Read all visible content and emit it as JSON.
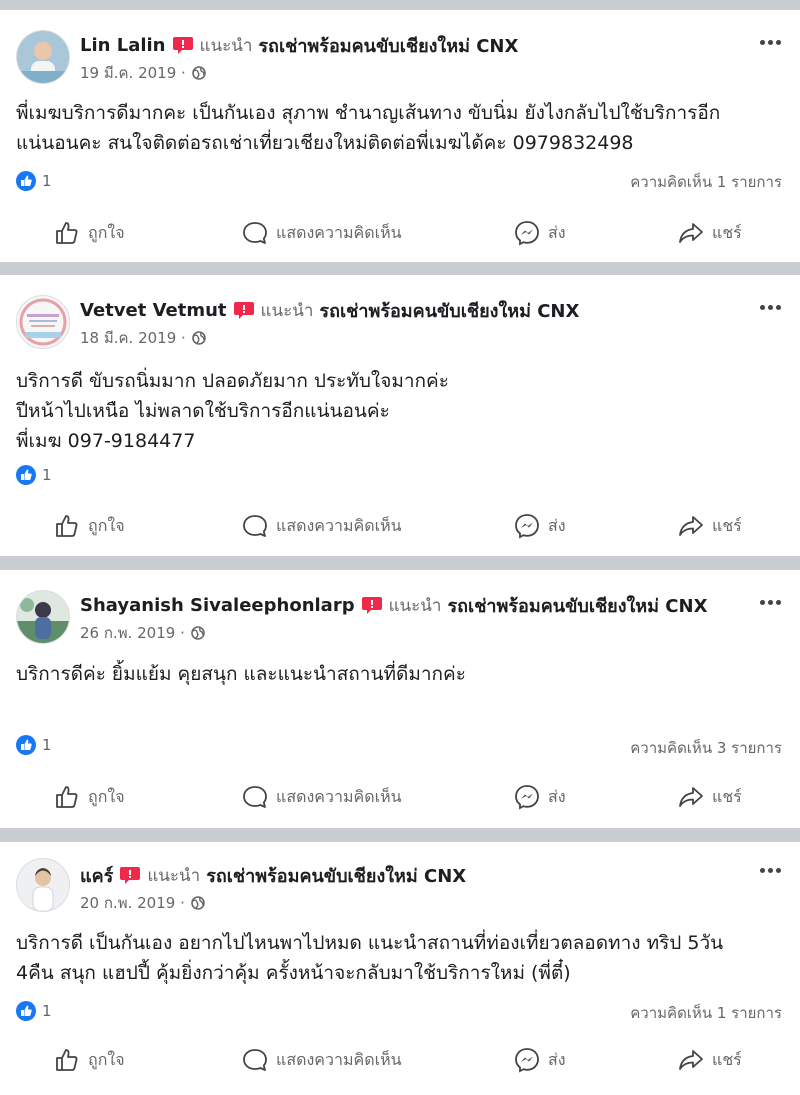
{
  "recommend_word": "แนะนำ",
  "actions": {
    "like": "ถูกใจ",
    "comment": "แสดงความคิดเห็น",
    "send": "ส่ง",
    "share": "แชร์"
  },
  "colors": {
    "like_blue": "#1877f2",
    "recommend_red": "#f02849",
    "muted": "#65676b",
    "divider": "#c9ccd1"
  },
  "posts": [
    {
      "author": "Lin Lalin",
      "page": "รถเช่าพร้อมคนขับเชียงใหม่ CNX",
      "date": "19 มี.ค. 2019 ·",
      "lines": [
        "พี่เมฆบริการดีมากคะ เป็นกันเอง สุภาพ ชำนาญเส้นทาง ขับนิ่ม ยังไงกลับไปใช้บริการอีก",
        "แน่นอนคะ สนใจติดต่อรถเช่าเที่ยวเชียงใหม่ติดต่อพี่เมฆได้คะ 0979832498"
      ],
      "reactions": "1",
      "comments": "ความคิดเห็น 1 รายการ"
    },
    {
      "author": "Vetvet Vetmut",
      "page": "รถเช่าพร้อมคนขับเชียงใหม่ CNX",
      "date": "18 มี.ค. 2019 ·",
      "lines": [
        "บริการดี ขับรถนิ่มมาก ปลอดภัยมาก ประทับใจมากค่ะ",
        "ปีหน้าไปเหนือ ไม่พลาดใช้บริการอีกแน่นอนค่ะ",
        "พี่เมฆ 097-9184477"
      ],
      "reactions": "1",
      "comments": ""
    },
    {
      "author": "Shayanish Sivaleephonlarp",
      "page": "รถเช่าพร้อมคนขับเชียงใหม่ CNX",
      "date": "26 ก.พ. 2019 ·",
      "lines": [
        "บริการดีค่ะ ยิ้มแย้ม คุยสนุก และแนะนำสถานที่ดีมากค่ะ"
      ],
      "reactions": "1",
      "comments": "ความคิดเห็น 3 รายการ"
    },
    {
      "author": "แคร์",
      "page": "รถเช่าพร้อมคนขับเชียงใหม่ CNX",
      "date": "20 ก.พ. 2019 ·",
      "lines": [
        "บริการดี เป็นกันเอง อยากไปไหนพาไปหมด แนะนำสถานที่ท่องเที่ยวตลอดทาง ทริป 5วัน",
        "4คืน สนุก แฮปปี้ คุ้มยิ่งกว่าคุ้ม ครั้งหน้าจะกลับมาใช้บริการใหม่ (พี่ตี๋)"
      ],
      "reactions": "1",
      "comments": "ความคิดเห็น 1 รายการ"
    }
  ]
}
